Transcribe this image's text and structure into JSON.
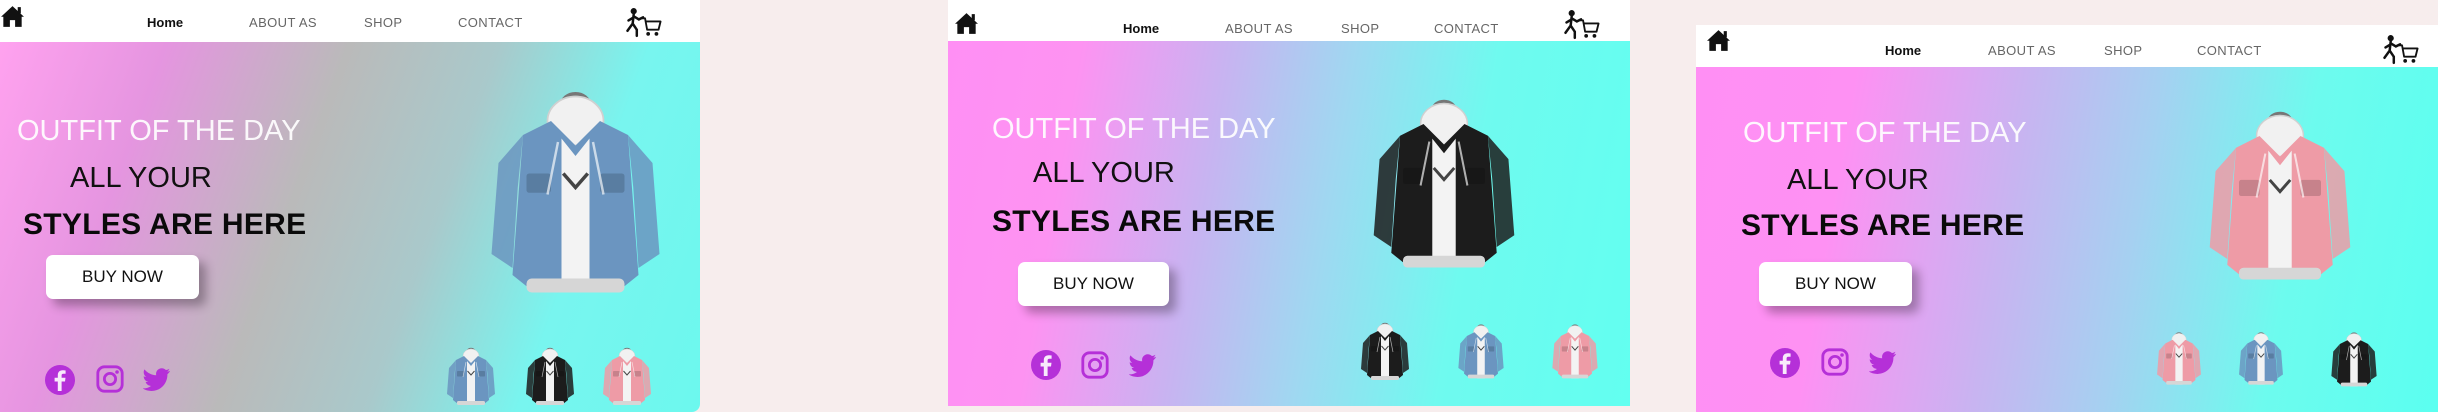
{
  "nav": {
    "links": [
      "Home",
      "ABOUT AS",
      "SHOP",
      "CONTACT"
    ]
  },
  "hero": {
    "kicker": "OUTFIT OF THE DAY",
    "line2": "ALL YOUR",
    "line3": "STYLES  ARE HERE",
    "cta": "BUY NOW"
  },
  "icons": {
    "home": "home-icon",
    "cart": "shopping-cart-icon",
    "social": [
      "facebook-icon",
      "instagram-icon",
      "twitter-icon"
    ]
  },
  "colors": {
    "pink": "#ff8ff4",
    "cyan": "#5cfff0",
    "social_purple": "#b530d8",
    "denim_blue": "#6b95c0",
    "jacket_black": "#1c1c1c",
    "jacket_pink": "#ee9ba6"
  },
  "frames": [
    {
      "featured": "denim-blue",
      "thumbnails": [
        "denim-blue",
        "black",
        "pink"
      ]
    },
    {
      "featured": "black",
      "thumbnails": [
        "black",
        "denim-blue",
        "pink"
      ]
    },
    {
      "featured": "pink",
      "thumbnails": [
        "pink",
        "denim-blue",
        "black"
      ]
    }
  ]
}
